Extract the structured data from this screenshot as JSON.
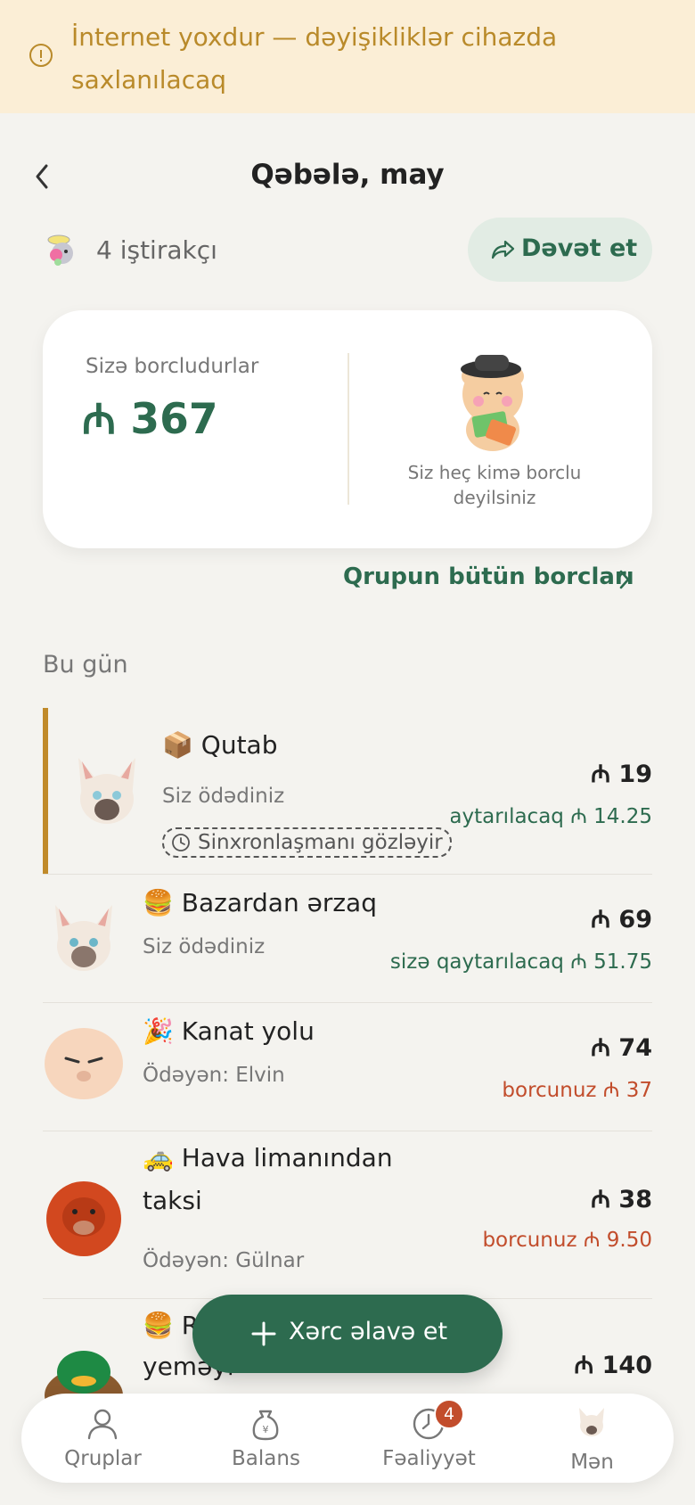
{
  "offline_banner": {
    "text": "İnternet yoxdur — dəyişikliklər cihazda saxlanılacaq",
    "icon": "alert-circle-icon"
  },
  "header": {
    "title": "Qəbələ, may",
    "back_icon": "chevron-left-icon"
  },
  "group": {
    "members": "4 iştirakçı",
    "invite_label": "Dəvət et"
  },
  "summary": {
    "owed_label": "Sizə borcludurlar",
    "owed_amount": "₼ 367",
    "no_debt_text": "Siz heç kimə borclu deyilsiniz"
  },
  "all_debts_link": "Qrupun bütün borcları",
  "section_today": "Bu gün",
  "expenses": [
    {
      "emoji": "📦",
      "name": "Qutab",
      "payer": "Siz ödədiniz",
      "amount": "₼ 19",
      "state": "sizə qaytarılacaq ₼ 14.25",
      "state_type": "credit",
      "sync": "Sinxronlaşmanı gözləyir"
    },
    {
      "emoji": "🍔",
      "name": "Bazardan ərzaq",
      "payer": "Siz ödədiniz",
      "amount": "₼ 69",
      "state": "sizə qaytarılacaq ₼ 51.75",
      "state_type": "credit"
    },
    {
      "emoji": "🎉",
      "name": "Kanat yolu",
      "payer": "Ödəyən: Elvin",
      "amount": "₼ 74",
      "state": "borcunuz ₼ 37",
      "state_type": "debt"
    },
    {
      "emoji": "🚕",
      "name": "Hava limanından taksi",
      "name_line1": "Hava limanından",
      "name_line2": "taksi",
      "payer": "Ödəyən: Gülnar",
      "amount": "₼ 38",
      "state": "borcunuz ₼ 9.50",
      "state_type": "debt"
    },
    {
      "emoji": "🍔",
      "name_line1": "R",
      "name_line2": "yeməyi",
      "amount": "₼ 140"
    }
  ],
  "fab_label": "Xərc əlavə et",
  "tabs": [
    {
      "label": "Qruplar",
      "icon": "users-icon"
    },
    {
      "label": "Balans",
      "icon": "money-bag-icon"
    },
    {
      "label": "Fəaliyyət",
      "icon": "clock-icon",
      "badge": "4"
    },
    {
      "label": "Mən",
      "icon": "profile-avatar-icon"
    }
  ],
  "colors": {
    "accent": "#2d6b4f",
    "debt": "#c24d2c",
    "banner_bg": "#fbeed6",
    "banner_text": "#b98a2a",
    "pending": "#c08a2a"
  }
}
